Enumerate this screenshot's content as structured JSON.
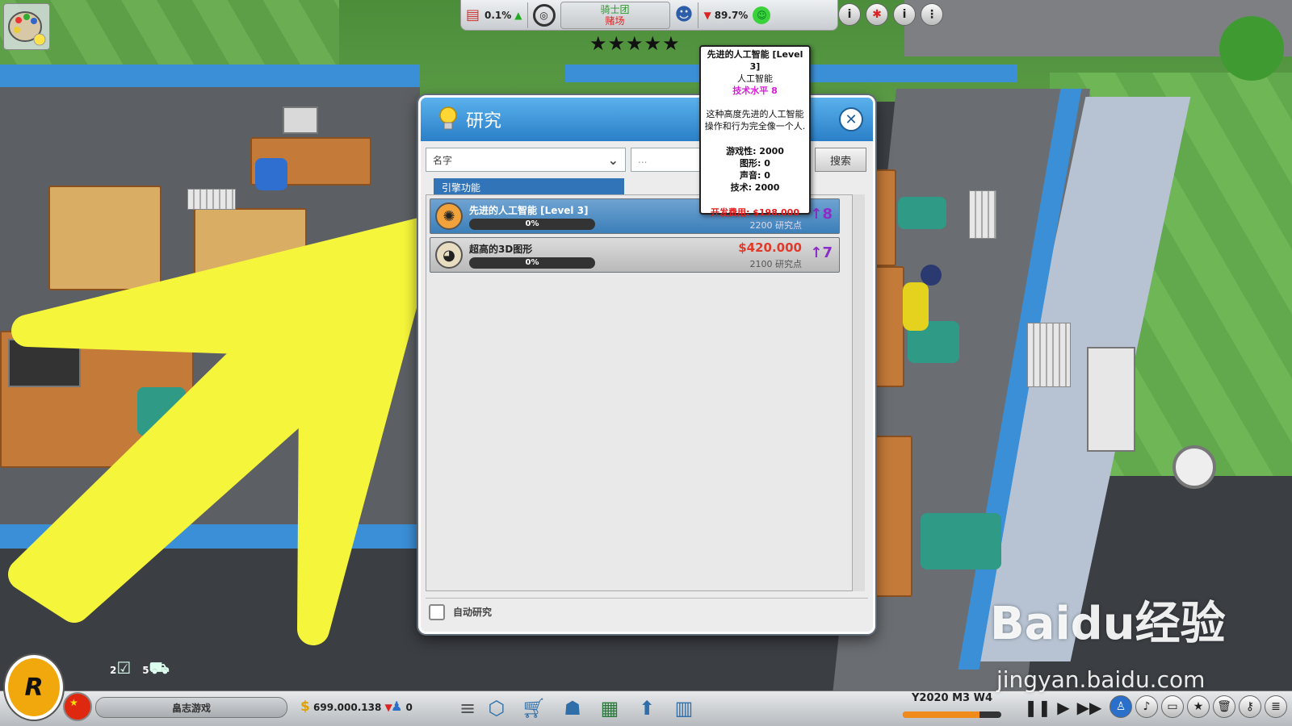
{
  "hud": {
    "reviews_pct": "0.1%",
    "reviews_trend": "▲",
    "genre_line1": "骑士团",
    "genre_line2": "赌场",
    "fans_trend": "▼",
    "fans_pct": "89.7%",
    "rating_stars": "★★★★★",
    "right_icons": [
      "info-icon",
      "fire-alarm-icon",
      "info-people-icon",
      "options-icon"
    ]
  },
  "research": {
    "title": "研究",
    "sort_select": "名字",
    "search_placeholder": "...",
    "search_button": "搜索",
    "tab_label": "引擎功能",
    "items": [
      {
        "name": "先进的人工智能 [Level 3]",
        "progress": "0%",
        "progress_value": 0,
        "cost": "",
        "points": "2200 研究点",
        "level": "8",
        "icon": "brain-icon",
        "selected": true
      },
      {
        "name": "超高的3D图形",
        "progress": "0%",
        "progress_value": 0,
        "cost": "$420.000",
        "points": "2100 研究点",
        "level": "7",
        "icon": "palette-icon",
        "selected": false
      }
    ],
    "auto_research_label": "自动研究",
    "auto_research_checked": false
  },
  "tooltip": {
    "title": "先进的人工智能 [Level 3]",
    "category": "人工智能",
    "tech_level": "技术水平 8",
    "description_line1": "这种高度先进的人工智能",
    "description_line2": "操作和行为完全像一个人.",
    "gameplay": "游戏性: 2000",
    "graphics": "图形: 0",
    "sound": "声音: 0",
    "tech": "技术: 2000",
    "dev_cost": "开发费用: $198.000"
  },
  "bottom": {
    "studio_name": "畠志游戏",
    "money": "699.000.138",
    "money_trend": "▼",
    "staff_count": "0",
    "task_count_1": "2",
    "task_count_2": "5",
    "date": "Y2020 M3 W4",
    "week_progress": 0.78
  },
  "watermark": {
    "brand": "Baidu经验",
    "url": "jingyan.baidu.com"
  },
  "colors": {
    "accent": "#2a7fc7",
    "cost_red": "#e23a2a",
    "level_purple": "#8a2ec6",
    "tech_magenta": "#d51fd4"
  }
}
